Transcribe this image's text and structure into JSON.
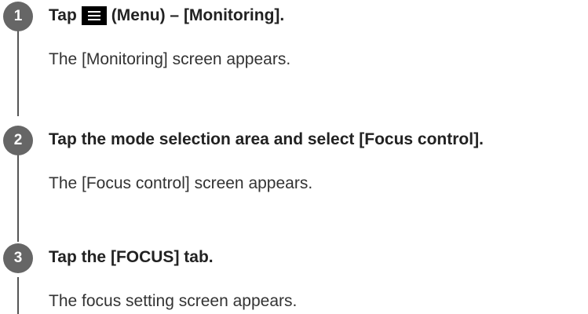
{
  "steps": [
    {
      "number": "1",
      "title_prefix": "Tap",
      "icon": "menu-icon",
      "title_suffix": "(Menu) – [Monitoring].",
      "description": "The [Monitoring] screen appears."
    },
    {
      "number": "2",
      "title": "Tap the mode selection area and select [Focus control].",
      "description": "The [Focus control] screen appears."
    },
    {
      "number": "3",
      "title": "Tap the [FOCUS] tab.",
      "description": "The focus setting screen appears."
    }
  ],
  "colors": {
    "badge": "#666666",
    "line": "#555555",
    "menu_icon_bg": "#000000"
  }
}
